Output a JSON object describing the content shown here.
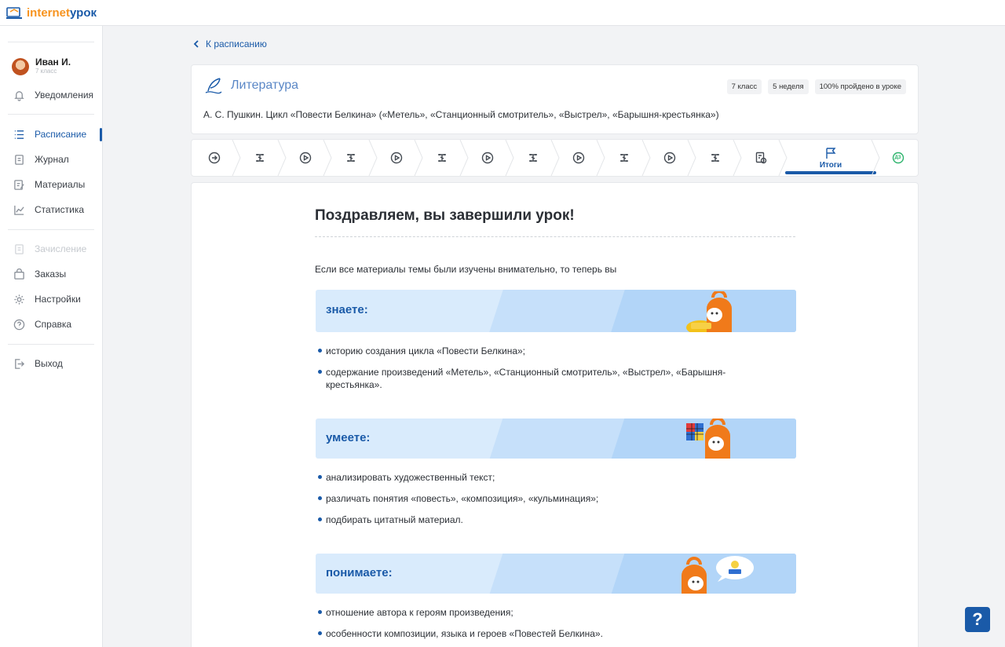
{
  "logo": {
    "part1": "internet",
    "part2": "урок"
  },
  "user": {
    "name": "Иван И.",
    "grade": "7 класс"
  },
  "nav": {
    "notifications": "Уведомления",
    "schedule": "Расписание",
    "journal": "Журнал",
    "materials": "Материалы",
    "statistics": "Статистика",
    "enrollment": "Зачисление",
    "orders": "Заказы",
    "settings": "Настройки",
    "help": "Справка",
    "logout": "Выход"
  },
  "back_label": "К расписанию",
  "lesson": {
    "subject": "Литература",
    "badges": [
      "7 класс",
      "5 неделя",
      "100% пройдено в уроке"
    ],
    "topic": "А. С. Пушкин. Цикл «Повести Белкина» («Метель», «Станционный смотритель», «Выстрел», «Барышня-крестьянка»)"
  },
  "steps": {
    "active_label": "Итоги",
    "homework_label": "ДЗ"
  },
  "summary": {
    "title": "Поздравляем, вы завершили урок!",
    "intro": "Если все материалы темы были изучены внимательно, то теперь вы",
    "know_title": "знаете:",
    "know": [
      "историю создания цикла «Повести Белкина»;",
      "содержание произведений «Метель», «Станционный смотритель», «Выстрел», «Барышня-крестьянка»."
    ],
    "can_title": "умеете:",
    "can": [
      "анализировать художественный текст;",
      "различать понятия «повесть», «композиция», «кульминация»;",
      "подбирать цитатный материал."
    ],
    "understand_title": "понимаете:",
    "understand": [
      "отношение автора к героям произведения;",
      "особенности композиции, языка и героев «Повестей Белкина»."
    ]
  },
  "help_button": "?",
  "colors": {
    "accent": "#1a5aa8",
    "logo_orange": "#f7931e",
    "homework_green": "#2bb36b"
  }
}
